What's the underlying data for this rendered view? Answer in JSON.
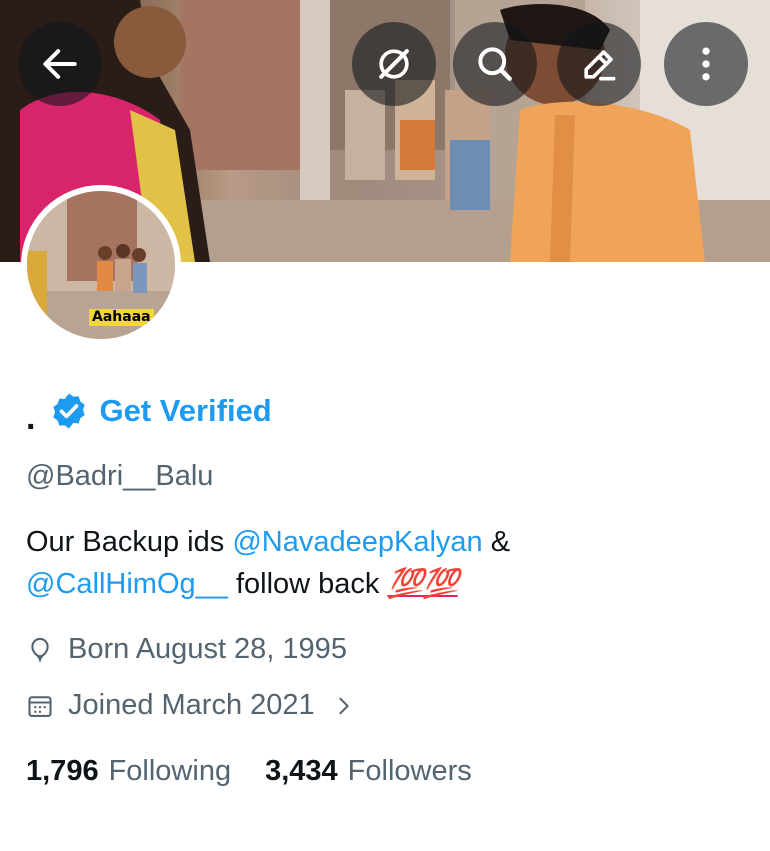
{
  "header": {
    "back_icon": "arrow-left-icon",
    "grok_icon": "no-sign-icon",
    "search_icon": "search-icon",
    "edit_icon": "pencil-icon",
    "more_icon": "more-vertical-icon"
  },
  "avatar": {
    "caption": "Aahaaa"
  },
  "profile": {
    "display_name": ".",
    "get_verified": "Get Verified",
    "handle": "@Badri__Balu",
    "bio_prefix": "Our Backup ids ",
    "bio_mention1": "@NavadeepKalyan",
    "bio_amp": " &",
    "bio_mention2": "@CallHimOg__",
    "bio_suffix": " follow back ",
    "bio_emoji": "💯💯",
    "born": "Born August 28, 1995",
    "joined": "Joined March 2021"
  },
  "stats": {
    "following_count": "1,796",
    "following_label": "Following",
    "followers_count": "3,434",
    "followers_label": "Followers"
  },
  "colors": {
    "accent": "#1d9bf0",
    "muted": "#536471",
    "text": "#0f1419"
  }
}
